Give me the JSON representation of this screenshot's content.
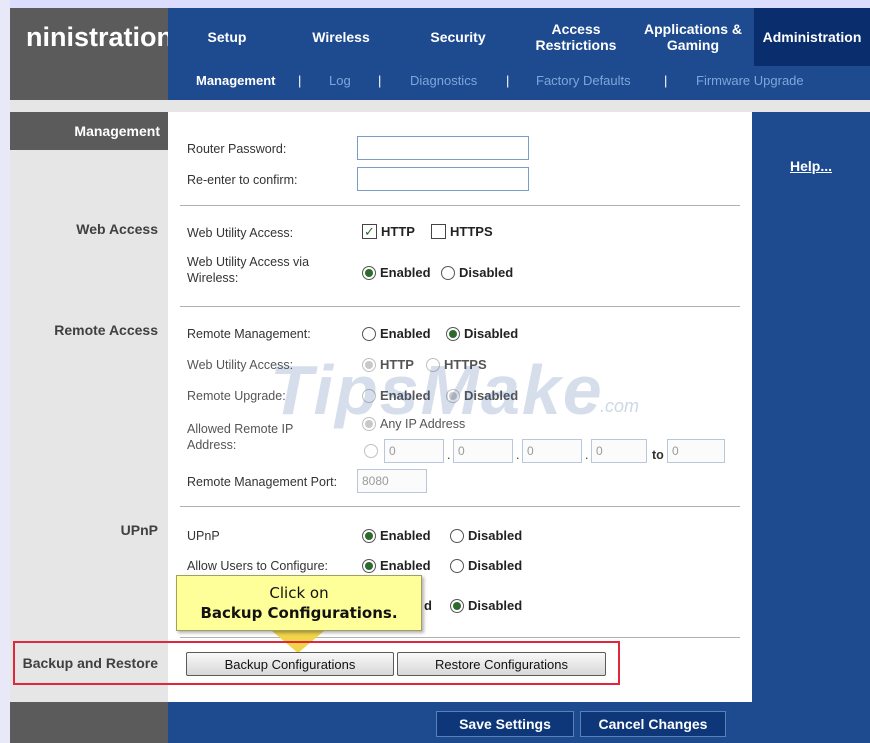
{
  "header": {
    "title_partial": "ninistration",
    "tabs": [
      {
        "label": "Setup"
      },
      {
        "label": "Wireless"
      },
      {
        "label": "Security"
      },
      {
        "label": "Access\nRestrictions"
      },
      {
        "label": "Applications &\nGaming"
      },
      {
        "label": "Administration"
      }
    ],
    "subtabs": [
      {
        "label": "Management"
      },
      {
        "label": "Log"
      },
      {
        "label": "Diagnostics"
      },
      {
        "label": "Factory Defaults"
      },
      {
        "label": "Firmware Upgrade"
      }
    ],
    "separator": "|"
  },
  "sidebar": {
    "heading": "Management",
    "sections": {
      "web_access": "Web Access",
      "remote_access": "Remote Access",
      "upnp": "UPnP",
      "backup": "Backup and Restore"
    }
  },
  "help": {
    "label": "Help..."
  },
  "form": {
    "router_password": "Router Password:",
    "reenter_confirm": "Re-enter to  confirm:",
    "web_utility_access": "Web Utility Access:",
    "http": "HTTP",
    "https": "HTTPS",
    "web_utility_wireless": "Web Utility Access via Wireless:",
    "enabled": "Enabled",
    "disabled": "Disabled",
    "remote_management": "Remote  Management:",
    "remote_web_utility_access": "Web Utility Access:",
    "remote_upgrade": "Remote Upgrade:",
    "allowed_remote_ip": "Allowed Remote IP Address:",
    "any_ip": "Any IP Address",
    "ip_octets": [
      "0",
      "0",
      "0",
      "0"
    ],
    "ip_to_label": "to",
    "ip_to_value": "0",
    "remote_mgmt_port": "Remote Management Port:",
    "port_value": "8080",
    "upnp_label": "UPnP",
    "allow_users_configure": "Allow Users to Configure:",
    "partial_enabled": "d",
    "backup_button": "Backup Configurations",
    "restore_button": "Restore Configurations"
  },
  "callout": {
    "line1": "Click on",
    "line2": "Backup Configurations."
  },
  "watermark": {
    "text": "TipsMake",
    "suffix": ".com"
  },
  "footer": {
    "save": "Save Settings",
    "cancel": "Cancel Changes"
  },
  "colors": {
    "nav_blue": "#1e4a8f",
    "active_tab": "#0a2d6e",
    "highlight_red": "#e0283c",
    "callout_yellow": "#ffff99"
  }
}
